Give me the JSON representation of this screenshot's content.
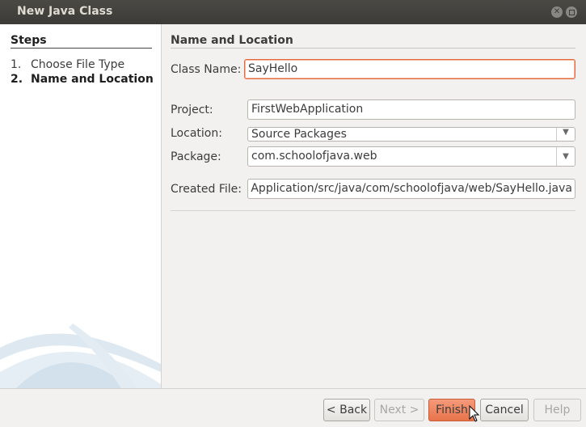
{
  "window": {
    "title": "New Java Class"
  },
  "steps": {
    "title": "Steps",
    "items": [
      {
        "num": "1.",
        "label": "Choose File Type"
      },
      {
        "num": "2.",
        "label": "Name and Location"
      }
    ]
  },
  "panel": {
    "title": "Name and Location",
    "class_name": {
      "label": "Class Name:",
      "value": "SayHello"
    },
    "project": {
      "label": "Project:",
      "value": "FirstWebApplication"
    },
    "location": {
      "label": "Location:",
      "value": "Source Packages"
    },
    "package": {
      "label": "Package:",
      "value": "com.schoolofjava.web"
    },
    "created_file": {
      "label": "Created File:",
      "value": "Application/src/java/com/schoolofjava/web/SayHello.java"
    }
  },
  "buttons": {
    "back": "< Back",
    "next": "Next >",
    "finish": "Finish",
    "cancel": "Cancel",
    "help": "Help"
  },
  "colors": {
    "accent": "#e8744b",
    "titlebar": "#3c3b37"
  }
}
